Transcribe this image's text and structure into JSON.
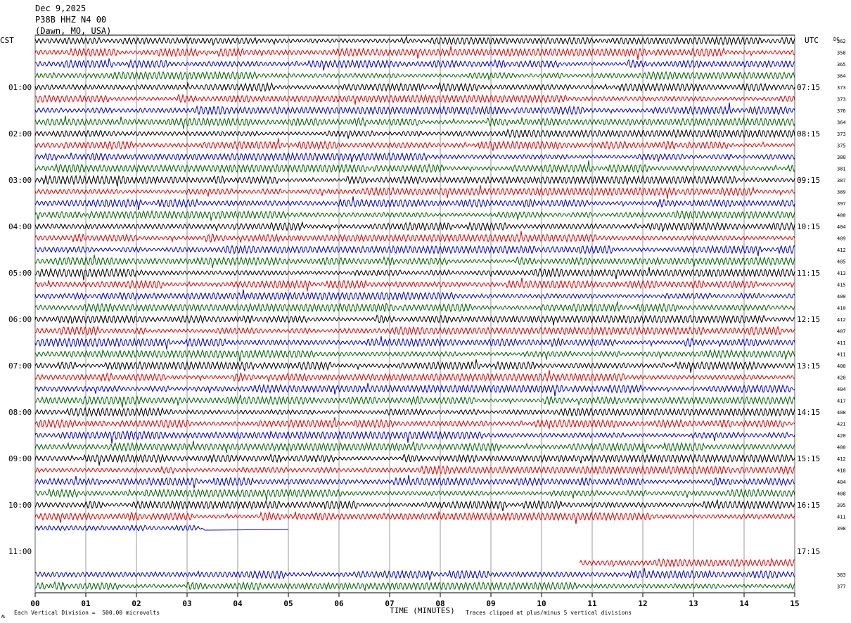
{
  "header": {
    "date": "Dec 9,2025",
    "station": "P38B HHZ N4 00",
    "location": "(Dawn, MO, USA)"
  },
  "chart_data": {
    "type": "line",
    "title": "Dec 9,2025",
    "left_axis_label": "CST",
    "right_axis_label": "UTC",
    "dc_label": "DC",
    "xlabel": "TIME (MINUTES)",
    "x_ticks": [
      "00",
      "01",
      "02",
      "03",
      "04",
      "05",
      "06",
      "07",
      "08",
      "09",
      "10",
      "11",
      "12",
      "13",
      "14",
      "15"
    ],
    "xlim": [
      0,
      15
    ],
    "left_hour_labels": [
      "01:00",
      "02:00",
      "03:00",
      "04:00",
      "05:00",
      "06:00",
      "07:00",
      "08:00",
      "09:00",
      "10:00",
      "11:00"
    ],
    "right_hour_labels": [
      "07:15",
      "08:15",
      "09:15",
      "10:15",
      "11:15",
      "12:15",
      "13:15",
      "14:15",
      "15:15",
      "16:15",
      "17:15"
    ],
    "trace_colors": [
      "#000000",
      "#e00000",
      "#0000c8",
      "#006400"
    ],
    "trace_minutes_each": 15,
    "traces_total": 48,
    "dc_offsets": [
      {
        "row": 0,
        "value": "362"
      },
      {
        "row": 1,
        "value": "358"
      },
      {
        "row": 2,
        "value": "365"
      },
      {
        "row": 3,
        "value": "364"
      },
      {
        "row": 4,
        "value": "373"
      },
      {
        "row": 5,
        "value": "373"
      },
      {
        "row": 6,
        "value": "376"
      },
      {
        "row": 7,
        "value": "364"
      },
      {
        "row": 8,
        "value": "373"
      },
      {
        "row": 9,
        "value": "375"
      },
      {
        "row": 10,
        "value": "380"
      },
      {
        "row": 11,
        "value": "381"
      },
      {
        "row": 12,
        "value": "387"
      },
      {
        "row": 13,
        "value": "389"
      },
      {
        "row": 14,
        "value": "397"
      },
      {
        "row": 15,
        "value": "400"
      },
      {
        "row": 16,
        "value": "404"
      },
      {
        "row": 17,
        "value": "409"
      },
      {
        "row": 18,
        "value": "412"
      },
      {
        "row": 19,
        "value": "405"
      },
      {
        "row": 20,
        "value": "413"
      },
      {
        "row": 21,
        "value": "415"
      },
      {
        "row": 22,
        "value": "400"
      },
      {
        "row": 23,
        "value": "410"
      },
      {
        "row": 24,
        "value": "412"
      },
      {
        "row": 25,
        "value": "407"
      },
      {
        "row": 26,
        "value": "411"
      },
      {
        "row": 27,
        "value": "411"
      },
      {
        "row": 28,
        "value": "400"
      },
      {
        "row": 29,
        "value": "420"
      },
      {
        "row": 30,
        "value": "404"
      },
      {
        "row": 31,
        "value": "417"
      },
      {
        "row": 32,
        "value": "408"
      },
      {
        "row": 33,
        "value": "421"
      },
      {
        "row": 34,
        "value": "420"
      },
      {
        "row": 35,
        "value": "400"
      },
      {
        "row": 36,
        "value": "412"
      },
      {
        "row": 37,
        "value": "418"
      },
      {
        "row": 38,
        "value": "404"
      },
      {
        "row": 39,
        "value": "408"
      },
      {
        "row": 40,
        "value": "395"
      },
      {
        "row": 41,
        "value": "411"
      },
      {
        "row": 42,
        "value": "398"
      },
      {
        "row": 46,
        "value": "383"
      },
      {
        "row": 47,
        "value": "377"
      }
    ],
    "segments": [
      {
        "row": 42,
        "start_min": 0,
        "end_min": 3.3,
        "note": "data then flat line to 5.0 min"
      },
      {
        "row": 45,
        "start_min": 10.75,
        "end_min": 15
      },
      {
        "row": 46,
        "start_min": 0,
        "end_min": 15
      },
      {
        "row": 47,
        "start_min": 0,
        "end_min": 15
      }
    ],
    "grid": true
  },
  "footer": {
    "scale_note": "Each Vertical Division =  500.00 microvolts",
    "clip_note": "Traces clipped at plus/minus 5 vertical divisions",
    "corner_mark": "ʍ"
  }
}
